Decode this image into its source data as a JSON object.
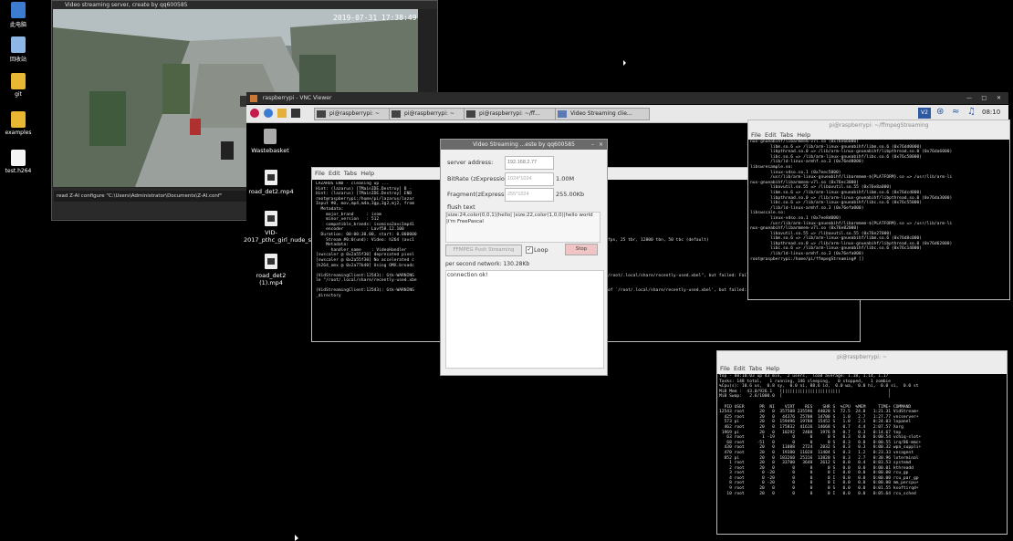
{
  "win_desktop": {
    "icons": [
      {
        "label": "此电脑"
      },
      {
        "label": "回收站"
      },
      {
        "label": "git"
      },
      {
        "label": "examples"
      },
      {
        "label": "test.h264"
      }
    ]
  },
  "video_window": {
    "title": "Video streaming server, create by qq600585",
    "timestamp": "2019-07-31 17:38:49",
    "log_line": "read Z-AI configure \"C:\\Users\\Administrator\\Documents\\Z-AI.conf\""
  },
  "vnc": {
    "title": "raspberrypi - VNC Viewer",
    "taskbar": {
      "tasks": [
        "pi@raspberrypi: ~",
        "pi@raspberrypi: ~",
        "pi@raspberrypi: ~/ff...",
        "Video Streaming clie..."
      ],
      "clock": "08:10",
      "badge": "V2"
    },
    "desktop_icons": [
      "Wastebasket",
      "road_det2.mp4",
      "VID-2017_pthc_girl_nude_sh...",
      "road_det2 (1).mp4"
    ],
    "term_left": {
      "menu": [
        "File",
        "Edit",
        "Tabs",
        "Help"
      ],
      "lines": [
        "LAZARUS END - cleaning up ...",
        "Hint: (lazarus) [TMainIDE.Destroy] B -",
        "Hint: (lazarus) [TMainIDE.Destroy] END",
        "root@raspberrypi:/home/pi/lazarus/lazar",
        "Input #0, mov,mp4,m4a,3gp,3g2,mj2, from",
        "  Metadata:",
        "    major_brand     : isom",
        "    minor_version   : 512",
        "    compatible_brands: isomiso2avc1mp41",
        "    encoder         : Lavf58.12.100",
        "  Duration: 00:00:30.00, start: 0.000000",
        "    Stream #0:0(und): Video: h264 (avc1",
        "    Metadata:",
        "      handler_name    : VideoHandler",
        "[swscaler @ 0x2a55f30] deprecated pixel",
        "[swscaler @ 0x2a55f30] No accelerated c",
        "[h264_omx @ 0x2a77b40] Using OMX.broadc",
        "",
        "(VidStreamingClient:12543): Gtk-WARNING",
        "le \"/root/.local/share/recently-used.xbe",
        "",
        "(VidStreamingClient:12543): Gtk-WARNING",
        "_directory"
      ],
      "right_lines": [
        "",
        "",
        "",
        "",
        "",
        "",
        "",
        "",
        "",
        "",
        "",
        "fps, 25 tbr, 12800 tbn, 50 tbc (default)",
        "",
        "",
        "",
        "",
        "",
        "",
        "/root/.local/share/recently-used.xbel\", but failed: Failed to create fi",
        "",
        "",
        "of `/root/.local/share/recently-used.xbel', but failed: No such file or"
      ]
    },
    "term_right": {
      "title": "pi@raspberrypi: ~/ffmpegStreaming",
      "menu": [
        "File",
        "Edit",
        "Tabs",
        "Help"
      ],
      "lines": [
        "nux-gnueabihf/libarmmem-v7l.so (0x76e6b000)",
        "        libm.so.6 => /lib/arm-linux-gnueabihf/libm.so.6 (0x76dd0000)",
        "        libpthread.so.0 => /lib/arm-linux-gnueabihf/libpthread.so.0 (0x76da6000)",
        "        libc.so.6 => /lib/arm-linux-gnueabihf/libc.so.6 (0x76c58000)",
        "        /lib/ld-linux-armhf.so.3 (0x76ed8000)",
        "libswresample.so:",
        "        linux-vdso.so.1 (0x7eec5000)",
        "        /usr/lib/arm-linux-gnueabihf/libarmmem-${PLATFORM}.so => /usr/lib/arm-li",
        "nux-gnueabihf/libarmmem-v7l.so (0x76ec3000)",
        "        libavutil.so.55 => /libavutil.so.55 (0x76e8a000)",
        "        libm.so.6 => /lib/arm-linux-gnueabihf/libm.so.6 (0x76dcd000)",
        "        libpthread.so.0 => /lib/arm-linux-gnueabihf/libpthread.so.0 (0x76da3000)",
        "        libc.so.6 => /lib/arm-linux-gnueabihf/libc.so.6 (0x76c55000)",
        "        /lib/ld-linux-armhf.so.3 (0x76efa000)",
        "libswscale.so:",
        "        linux-vdso.so.1 (0x7ee8d000)",
        "        /usr/lib/arm-linux-gnueabihf/libarmmem-${PLATFORM}.so => /usr/lib/arm-li",
        "nux-gnueabihf/libarmmem-v7l.so (0x76e82000)",
        "        libavutil.so.55 => /libavutil.so.55 (0x76e27000)",
        "        libm.so.6 => /lib/arm-linux-gnueabihf/libm.so.6 (0x76d8c000)",
        "        libpthread.so.0 => /lib/arm-linux-gnueabihf/libpthread.so.0 (0x76d62000)",
        "        libc.so.6 => /lib/arm-linux-gnueabihf/libc.so.6 (0x76c14000)",
        "        /lib/ld-linux-armhf.so.3 (0x76efa000)",
        "root@raspberrypi:/home/pi/ffmpegStreaming# []"
      ]
    },
    "term_top": {
      "title": "pi@raspberrypi: ~",
      "menu": [
        "File",
        "Edit",
        "Tabs",
        "Help"
      ],
      "lines": [
        "top - 08:10:03 up 43 min,  2 users,  load average: 1.18, 1.14, 1.17",
        "Tasks: 148 total,   1 running, 146 sleeping,   0 stopped,   1 zombie",
        "%Cpu(s): 10.6 us,  0.8 sy,  0.0 ni, 88.6 id,  0.0 wa,  0.0 hi,  0.0 si,  0.0 st",
        "MiB Mem :  43.0/926.1   [|||||||||||||||||||||||                   ]",
        "MiB Swap:   2.6/1000.0  [                                          ]",
        "",
        "  PID USER      PR  NI    VIRT    RES    SHR S  %CPU  %MEM     TIME+ COMMAND",
        "12543 root      20   0  357508 235596  44020 S  72.5  24.8   1:21.31 VidStream+",
        "  425 root      20   0   44376  25708  14700 S   1.0   2.7   1:27.77 vncserver+",
        "  573 pi        20   0  159496  19788  15452 S   1.0   2.1   0:24.03 lxpanel",
        "  462 root      20   0  175832  41616  14668 S   0.7   4.4   2:07.57 Xorg",
        " 1969 pi        20   0   10292   2488   1976 R   0.7   0.3   0:14.67 top",
        "   63 root       1 -19       0      0      0 S   0.3   0.0   0:00.54 vchiq-slot+",
        "   68 root     -51   0       0      0      0 S   0.3   0.0   0:00.55 irq/86-mmc+",
        "  430 root      20   0   11088   2724   2032 S   0.3   0.3   0:00.32 wpa_suppli+",
        "  470 root      20   0   19380  11020  11404 S   0.3   1.2   0:23.33 vncagent",
        "  852 pi        20   0  183260  25316  13820 S   0.3   2.7   0:30.96 lxterminal",
        "    1 root      20   0   33700   3648   2612 S   0.0   0.4   0:03.53 systemd",
        "    2 root      20   0       0      0      0 S   0.0   0.0   0:00.01 kthreadd",
        "    3 root       0 -20       0      0      0 I   0.0   0.0   0:00.00 rcu_gp",
        "    4 root       0 -20       0      0      0 I   0.0   0.0   0:00.00 rcu_par_gp",
        "    8 root       0 -20       0      0      0 I   0.0   0.0   0:00.00 mm_percpu+",
        "    9 root      20   0       0      0      0 S   0.0   0.0   0:01.55 ksoftirqd+",
        "   10 root      20   0       0      0      0 I   0.0   0.0   0:05.64 rcu_sched"
      ]
    },
    "dialog": {
      "title": "Video Streaming ...este by qq600585",
      "server_label": "server address:",
      "server_placeholder": "192.168.2.77",
      "bitrate_label": "BitRate (zExpressio",
      "bitrate_value": "1024*1024",
      "bitrate_display": "1.00M",
      "fragment_label": "Fragment(zExpressi",
      "fragment_value": "255*1024",
      "fragment_display": "255.00Kb",
      "flush_label": "flush text",
      "flush_text": "|size:24,color(0,0,1)|hello| |size:22,color(1,0,0)|hello world\n|i'm FreePascal",
      "push_button": "FFMPEG Push Streaming",
      "loop_label": "Loop",
      "stop_button": "Stop",
      "network_label": "per second network: 130.28Kb",
      "log_text": "connection ok!"
    }
  }
}
